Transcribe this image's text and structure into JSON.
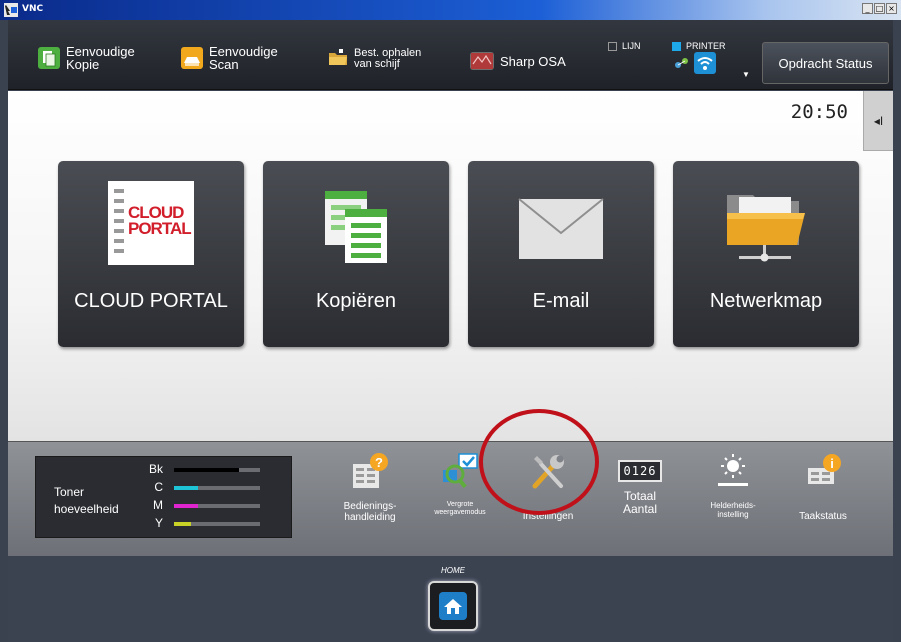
{
  "window": {
    "title": "VNC",
    "controls": [
      "_",
      "□",
      "×"
    ]
  },
  "toolbar": {
    "items": [
      {
        "line1": "Eenvoudige",
        "line2": "Kopie",
        "icon": "copy-icon",
        "color": "#4caf3f"
      },
      {
        "line1": "Eenvoudige",
        "line2": "Scan",
        "icon": "scan-icon",
        "color": "#f2a81d"
      },
      {
        "line1": "Best. ophalen",
        "line2": "van schijf",
        "icon": "folder-icon",
        "color": "#d8a63a"
      },
      {
        "line1": "Sharp OSA",
        "line2": "",
        "icon": "osa-icon",
        "color": "#b0393a"
      }
    ],
    "status": {
      "line_label": "LIJN",
      "printer_label": "PRINTER"
    },
    "job_status_button": "Opdracht Status"
  },
  "main": {
    "clock": "20:50",
    "side_tab": "◂I",
    "tiles": [
      {
        "label": "CLOUD PORTAL",
        "icon": "cloud-portal-icon",
        "icon_text_1": "CLOUD",
        "icon_text_2": "PORTAL"
      },
      {
        "label": "Kopiëren",
        "icon": "copy-documents-icon"
      },
      {
        "label": "E-mail",
        "icon": "envelope-icon"
      },
      {
        "label": "Netwerkmap",
        "icon": "network-folder-icon"
      }
    ]
  },
  "toner": {
    "title_1": "Toner",
    "title_2": "hoeveelheid",
    "levels": [
      {
        "key": "Bk",
        "fraction": 0.75,
        "color": "#000000"
      },
      {
        "key": "C",
        "fraction": 0.28,
        "color": "#1fc3d6"
      },
      {
        "key": "M",
        "fraction": 0.28,
        "color": "#e025d0"
      },
      {
        "key": "Y",
        "fraction": 0.2,
        "color": "#c9d227"
      }
    ]
  },
  "tray": {
    "items": [
      {
        "label": "Bedienings-\nhandleiding",
        "icon": "manual-icon"
      },
      {
        "label": "Vergrote\nweergavemodus",
        "icon": "magnifier-icon"
      },
      {
        "label": "Instellingen",
        "icon": "tools-icon"
      },
      {
        "label": "Totaal\nAantal",
        "icon": "counter-icon",
        "counter_text": "0126"
      },
      {
        "label": "Helderheids-\ninstelling",
        "icon": "brightness-icon"
      },
      {
        "label": "Taakstatus",
        "icon": "job-status-icon"
      }
    ]
  },
  "home": {
    "label": "HOME"
  }
}
